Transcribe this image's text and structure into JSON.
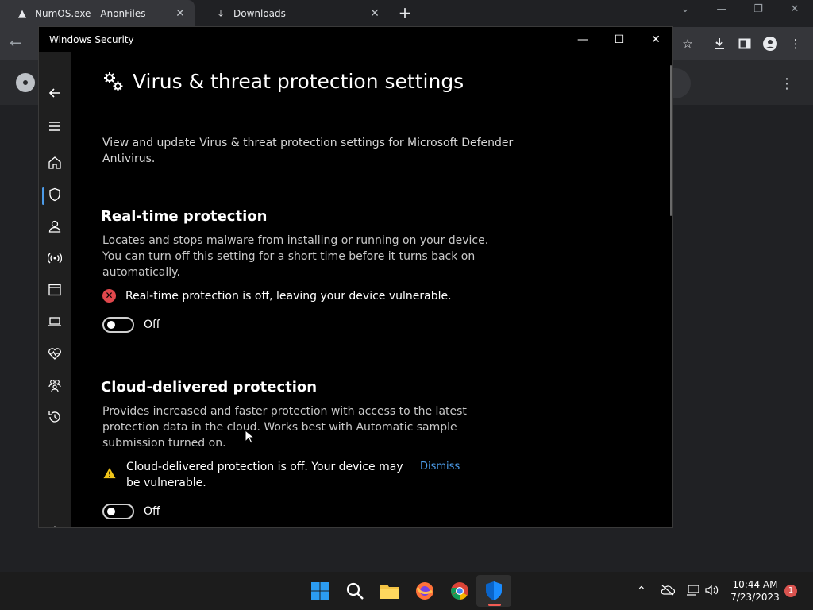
{
  "browser": {
    "tabs": [
      {
        "label": "NumOS.exe - AnonFiles",
        "active": true
      },
      {
        "label": "Downloads",
        "active": false
      }
    ],
    "new_tab_glyph": "+"
  },
  "window": {
    "title": "Windows Security"
  },
  "page": {
    "title": "Virus & threat protection settings",
    "intro": "View and update Virus & threat protection settings for Microsoft Defender Antivirus."
  },
  "sections": {
    "realtime": {
      "heading": "Real-time protection",
      "description": "Locates and stops malware from installing or running on your device. You can turn off this setting for a short time before it turns back on automatically.",
      "status": "Real-time protection is off, leaving your device vulnerable.",
      "toggle_label": "Off"
    },
    "cloud": {
      "heading": "Cloud-delivered protection",
      "description": "Provides increased and faster protection with access to the latest protection data in the cloud. Works best with Automatic sample submission turned on.",
      "status": "Cloud-delivered protection is off. Your device may be vulnerable.",
      "dismiss": "Dismiss",
      "toggle_label": "Off"
    }
  },
  "taskbar": {
    "time": "10:44 AM",
    "date": "7/23/2023",
    "notifications": "1"
  },
  "colors": {
    "accent": "#4c9be8",
    "error": "#e0474c",
    "warning": "#f0c419"
  }
}
